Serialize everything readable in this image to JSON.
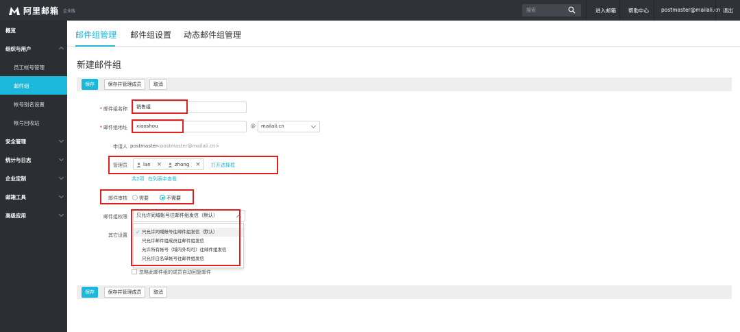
{
  "topbar": {
    "logo_text": "阿里邮箱",
    "edition": "企业版",
    "search_placeholder": "搜索",
    "enter_mail": "进入邮箱",
    "help_center": "帮助中心",
    "account": "postmaster@mailali.cn",
    "logout": "退出"
  },
  "sidebar": {
    "items": [
      {
        "label": "概览"
      },
      {
        "label": "组织与用户"
      },
      {
        "label": "员工帐号管理"
      },
      {
        "label": "邮件组"
      },
      {
        "label": "帐号别名设置"
      },
      {
        "label": "帐号回收站"
      },
      {
        "label": "安全管理"
      },
      {
        "label": "统计与日志"
      },
      {
        "label": "企业定制"
      },
      {
        "label": "邮箱工具"
      },
      {
        "label": "高级应用"
      }
    ]
  },
  "tabs": [
    {
      "label": "邮件组管理"
    },
    {
      "label": "邮件组设置"
    },
    {
      "label": "动态邮件组管理"
    }
  ],
  "page_title": "新建邮件组",
  "toolbar": {
    "save": "保存",
    "save_manage": "保存并管理成员",
    "cancel": "取消"
  },
  "form": {
    "name_label": "邮件组名称",
    "name_value": "销售组",
    "address_label": "邮件组地址",
    "address_value": "xiaoshou",
    "at": "@",
    "domain_value": "mailali.cn",
    "applicant_label": "申请人",
    "applicant_value": "postmaster",
    "applicant_email": "<postmaster@mailali.cn>",
    "admin_label": "管理员",
    "admins": [
      "lan",
      "zhong"
    ],
    "open_selector": "打开选择框",
    "admin_count": "共2项",
    "view_in_list": "在列表中查看",
    "review_label": "邮件审核",
    "review_no_need_not": "需要",
    "review_not_needed": "不需要",
    "permission_label": "邮件组权限",
    "permission_value": "只允许同域帐号往邮件组发信（默认）",
    "other_settings_label": "其它设置",
    "permission_options": [
      "只允许同域帐号往邮件组发信（默认）",
      "只允许邮件组成员往邮件组发信",
      "允许所有帐号（域内外均可）往邮件组发信",
      "只允许白名单帐号往邮件组发信"
    ],
    "other_checkbox_label": "忽略此邮件组的成员自动回复邮件"
  },
  "colors": {
    "accent": "#1bb8dc",
    "highlight": "#e0201c",
    "sidebar_bg": "#2b2e33",
    "topbar_bg": "#2f3237"
  }
}
